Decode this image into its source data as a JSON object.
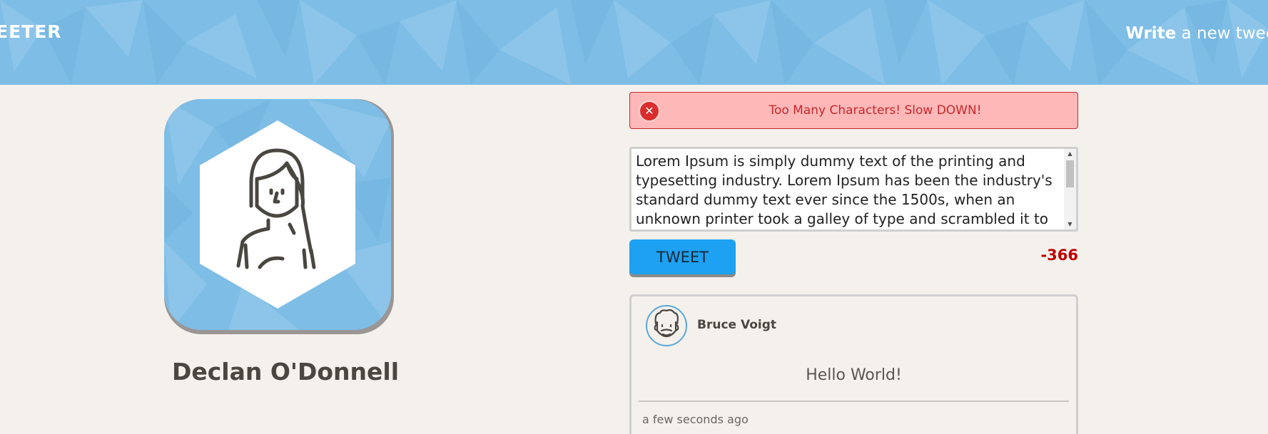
{
  "header": {
    "brand": "EETER",
    "compose_strong": "Write",
    "compose_rest": " a new tweet"
  },
  "profile": {
    "name": "Declan O'Donnell",
    "avatar_icon": "woman-avatar-icon"
  },
  "error": {
    "icon": "close-circle-icon",
    "message": "Too Many Characters! Slow DOWN!"
  },
  "composer": {
    "text": "Lorem Ipsum is simply dummy text of the printing and typesetting industry. Lorem Ipsum has been the industry's standard dummy text ever since the 1500s, when an unknown printer took a galley of type and scrambled it to make a type",
    "button_label": "TWEET",
    "char_count": "-366"
  },
  "tweets": [
    {
      "author": "Bruce Voigt",
      "avatar_icon": "man-avatar-icon",
      "content": "Hello World!",
      "time": "a few seconds ago"
    }
  ],
  "colors": {
    "header_blue": "#7dbde6",
    "background": "#f4f1ec",
    "error_red": "#c5282c",
    "error_bg": "#ffb8b8",
    "tweet_button": "#1da1f2",
    "counter_red": "#c00000"
  }
}
